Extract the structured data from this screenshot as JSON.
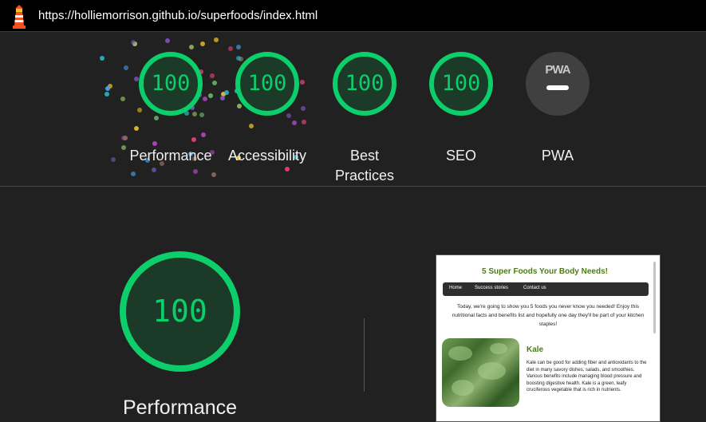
{
  "topbar": {
    "url": "https://holliemorrison.github.io/superfoods/index.html",
    "icon": "lighthouse-icon"
  },
  "scores": {
    "performance": {
      "label": "Performance",
      "value": "100"
    },
    "accessibility": {
      "label": "Accessibility",
      "value": "100"
    },
    "best_practices": {
      "label": "Best Practices",
      "value": "100"
    },
    "seo": {
      "label": "SEO",
      "value": "100"
    },
    "pwa": {
      "label": "PWA",
      "badge": "PWA",
      "icon": "pwa-badge-icon"
    }
  },
  "section": {
    "score": "100",
    "title": "Performance"
  },
  "preview": {
    "page_title": "5 Super Foods Your Body Needs!",
    "nav": [
      "Home",
      "Success stories",
      "Contact us"
    ],
    "intro": "Today, we're going to show you 5 foods you never know you needed! Enjoy this nutritional facts and benefits list and hopefully one day they'll be part of your kitchen staples!",
    "item_title": "Kale",
    "item_body": "Kale can be good for adding fiber and antioxidants to the diet in many savory dishes, salads, and smoothies. Various benefits include managing blood pressure and boosting digestive health. Kale is a green, leafy cruciferous vegetable that is rich in nutrients."
  },
  "colors": {
    "pass": "#0cce6b",
    "pass_bg": "#1b3a28",
    "background": "#212121",
    "accent_green": "#4c7a1a"
  }
}
